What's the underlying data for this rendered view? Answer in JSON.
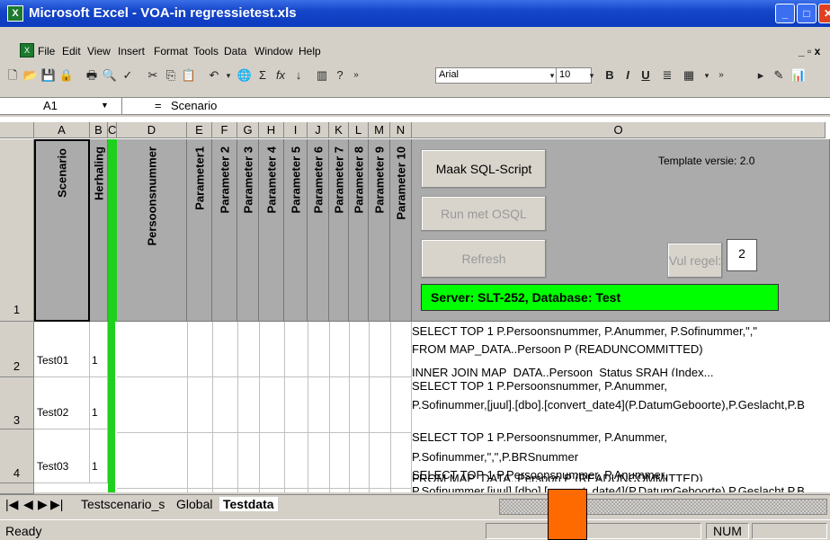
{
  "window": {
    "title": "Microsoft Excel - VOA-in regressietest.xls"
  },
  "menu": [
    "File",
    "Edit",
    "View",
    "Insert",
    "Format",
    "Tools",
    "Data",
    "Window",
    "Help"
  ],
  "toolbar": {
    "font_name": "Arial",
    "font_size": "10"
  },
  "formula_bar": {
    "cell_ref": "A1",
    "value": "Scenario"
  },
  "columns": [
    "A",
    "B",
    "C",
    "D",
    "E",
    "F",
    "G",
    "H",
    "I",
    "J",
    "K",
    "L",
    "M",
    "N",
    "O"
  ],
  "header_row": {
    "scenario": "Scenario",
    "herhaling": "Herhaling",
    "persoonsnummer": "Persoonsnummer",
    "params": [
      "Parameter1",
      "Parameter 2",
      "Parameter 3",
      "Parameter 4",
      "Parameter 5",
      "Parameter 6",
      "Parameter 7",
      "Parameter 8",
      "Parameter 9",
      "Parameter 10"
    ]
  },
  "buttons": {
    "maak": "Maak SQL-Script",
    "run": "Run met OSQL",
    "refresh": "Refresh",
    "vul": "Vul regel:"
  },
  "vul_value": "2",
  "template_version": "Template versie: 2.0",
  "server_info": "Server: SLT-252, Database: Test",
  "rows": [
    {
      "num": "1"
    },
    {
      "num": "2",
      "scenario": "Test01",
      "herhaling": "1",
      "sql1": "SELECT     TOP 1 P.Persoonsnummer, P.Anummer, P.Sofinummer,\",\"",
      "sql2": "FROM       MAP_DATA..Persoon P (READUNCOMMITTED)",
      "sql3": "INNER JOIN MAP_DATA..Persoon_Status SRAH (Index..."
    },
    {
      "num": "3",
      "scenario": "Test02",
      "herhaling": "1",
      "sql1": "SELECT     TOP 1 P.Persoonsnummer, P.Anummer,",
      "sql2": "P.Sofinummer,[juul].[dbo].[convert_date4](P.DatumGeboorte),P.Geslacht,P.B"
    },
    {
      "num": "4",
      "scenario": "Test03",
      "herhaling": "1",
      "sql1": "SELECT     TOP 1 P.Persoonsnummer, P.Anummer,",
      "sql2": "P.Sofinummer,\",\",P.BRSnummer",
      "sql3": "FROM       MAP_DATA..Persoon P (READUNCOMMITTED)"
    },
    {
      "num": "",
      "sql1": "SELECT     TOP 1 P.Persoonsnummer, P.Anummer,",
      "sql2": "P.Sofinummer,[juul].[dbo].[convert_date4](P.DatumGeboorte),P.Geslacht,P.B"
    }
  ],
  "sheet_tabs": [
    "Testscenario_s",
    "Global",
    "Testdata"
  ],
  "status": {
    "text": "Ready",
    "num": "NUM"
  },
  "colors": {
    "green_bar": "#00ff00",
    "title_blue": "#1545c8",
    "header_gray": "#ababab",
    "orange": "#ff6a00"
  }
}
